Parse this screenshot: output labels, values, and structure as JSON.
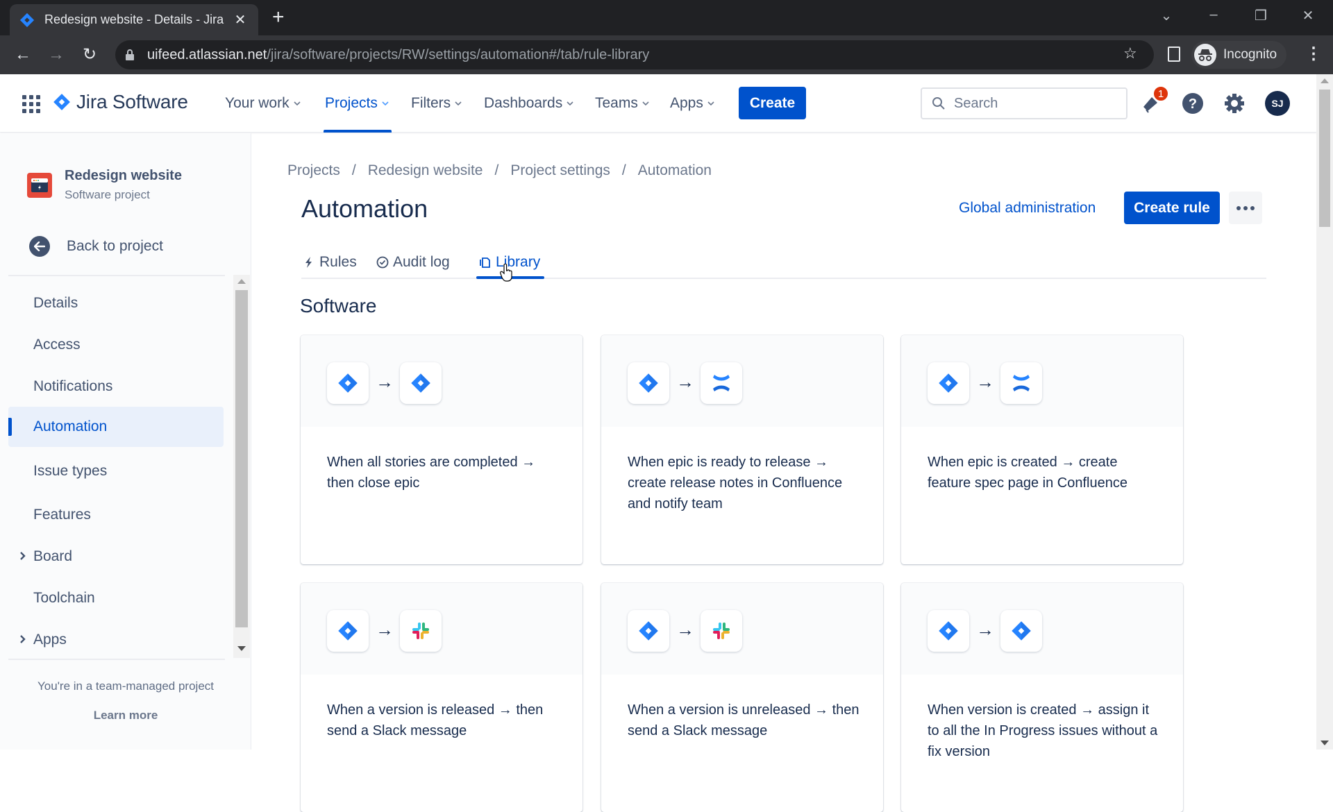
{
  "browser": {
    "tab_title": "Redesign website - Details - Jira",
    "url_host": "uifeed.atlassian.net",
    "url_path": "/jira/software/projects/RW/settings/automation#/tab/rule-library",
    "profile_label": "Incognito"
  },
  "header": {
    "product": "Jira Software",
    "nav": [
      {
        "label": "Your work"
      },
      {
        "label": "Projects"
      },
      {
        "label": "Filters"
      },
      {
        "label": "Dashboards"
      },
      {
        "label": "Teams"
      },
      {
        "label": "Apps"
      }
    ],
    "create_label": "Create",
    "search_placeholder": "Search",
    "notification_count": "1",
    "avatar_initials": "SJ"
  },
  "sidebar": {
    "project_name": "Redesign website",
    "project_type": "Software project",
    "back_label": "Back to project",
    "items": [
      {
        "label": "Details"
      },
      {
        "label": "Access"
      },
      {
        "label": "Notifications"
      },
      {
        "label": "Automation"
      },
      {
        "label": "Issue types"
      },
      {
        "label": "Features"
      },
      {
        "label": "Board"
      },
      {
        "label": "Toolchain"
      },
      {
        "label": "Apps"
      }
    ],
    "footer_text": "You're in a team-managed project",
    "learn_more": "Learn more"
  },
  "main": {
    "breadcrumb": [
      "Projects",
      "Redesign website",
      "Project settings",
      "Automation"
    ],
    "title": "Automation",
    "global_admin": "Global administration",
    "create_rule": "Create rule",
    "tabs": [
      {
        "label": "Rules"
      },
      {
        "label": "Audit log"
      },
      {
        "label": "Library"
      }
    ],
    "section": "Software",
    "arrow": "→",
    "cards": [
      {
        "from": "jira",
        "to": "jira",
        "text": "When all stories are completed → then close epic"
      },
      {
        "from": "jira",
        "to": "confluence",
        "text": "When epic is ready to release → create release notes in Confluence and notify team"
      },
      {
        "from": "jira",
        "to": "confluence",
        "text": "When epic is created → create feature spec page in Confluence"
      },
      {
        "from": "jira",
        "to": "slack",
        "text": "When a version is released → then send a Slack message"
      },
      {
        "from": "jira",
        "to": "slack",
        "text": "When a version is unreleased → then send a Slack message"
      },
      {
        "from": "jira",
        "to": "jira",
        "text": "When version is created → assign it to all the In Progress issues without a fix version"
      }
    ]
  },
  "colors": {
    "brand": "#0052cc",
    "badge": "#de350b",
    "project_icon": "#e5493a"
  }
}
